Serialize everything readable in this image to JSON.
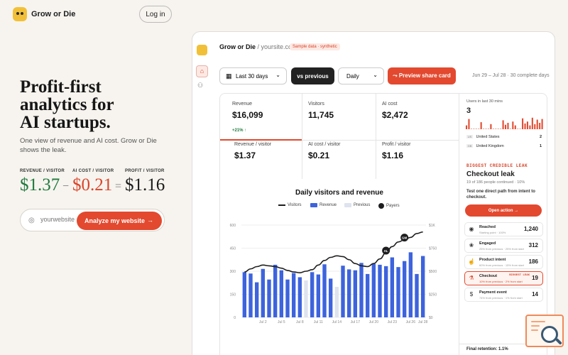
{
  "brand": {
    "name": "Grow or Die"
  },
  "nav": {
    "login": "Log in"
  },
  "hero": {
    "title_lines": [
      "Profit-first",
      "analytics for",
      "AI startups."
    ],
    "subtitle": "One view of revenue and AI cost. Grow or Die shows the leak."
  },
  "equation": {
    "revenue": {
      "label": "REVENUE / VISITOR",
      "value": "$1.37"
    },
    "minus": "−",
    "ai_cost": {
      "label": "AI COST / VISITOR",
      "value": "$0.21"
    },
    "equals": "=",
    "profit": {
      "label": "PROFIT / VISITOR",
      "value": "$1.16"
    }
  },
  "analyze": {
    "placeholder": "yourwebsite",
    "button": "Analyze my website",
    "arrow": "→"
  },
  "dashboard": {
    "title": "Grow or Die",
    "site": "/ yoursite.com",
    "badge": "Sample data · synthetic",
    "range": "Last 30 days",
    "compare": "vs previous",
    "granularity": "Daily",
    "share": "Preview share card",
    "share_icon": "share-icon",
    "date_range": "Jun 29 – Jul 28 · 30 complete days",
    "kpis": [
      {
        "label": "Revenue",
        "value": "$16,099",
        "delta": "+21% ↑"
      },
      {
        "label": "Visitors",
        "value": "11,745"
      },
      {
        "label": "AI cost",
        "value": "$2,472"
      },
      {
        "label": "Revenue / visitor",
        "value": "$1.37"
      },
      {
        "label": "AI cost / visitor",
        "value": "$0.21"
      },
      {
        "label": "Profit / visitor",
        "value": "$1.16"
      }
    ],
    "right": {
      "users_label": "Users in last 30 mins",
      "users_count": "3",
      "countries": [
        {
          "code": "US",
          "name": "United States",
          "count": "2"
        },
        {
          "code": "GB",
          "name": "United Kingdom",
          "count": "1"
        }
      ],
      "leak_label": "BIGGEST CREDIBLE LEAK",
      "leak_title": "Checkout leak",
      "leak_note": "19 of 186 people continued · 10%",
      "leak_desc": "Test one direct path from intent to checkout.",
      "open_action": "Open action →",
      "funnel": [
        {
          "icon": "◉",
          "name": "Reached",
          "sub": "Starting point · 100%",
          "value": "1,240"
        },
        {
          "icon": "❀",
          "name": "Engaged",
          "sub": "25% from previous · 25% from start",
          "value": "312"
        },
        {
          "icon": "☝",
          "name": "Product intent",
          "sub": "60% from previous · 15% from start",
          "value": "186"
        },
        {
          "icon": "⚗",
          "name": "Checkout",
          "sub": "10% from previous · 2% from start",
          "value": "19",
          "badge": "BIGGEST LEAK",
          "highlight": true
        },
        {
          "icon": "$",
          "name": "Payment event",
          "sub": "74% from previous · 1% from start",
          "value": "14"
        }
      ],
      "retention": "Final retention: 1.1%"
    }
  },
  "chart_data": {
    "type": "bar",
    "title": "Daily visitors and revenue",
    "legend": [
      "Visitors",
      "Revenue",
      "Previous",
      "Payers"
    ],
    "legend_placement": "top",
    "categories": [
      "Jun 29",
      "Jun 30",
      "Jul 1",
      "Jul 2",
      "Jul 3",
      "Jul 4",
      "Jul 5",
      "Jul 6",
      "Jul 7",
      "Jul 8",
      "Jul 9",
      "Jul 10",
      "Jul 11",
      "Jul 12",
      "Jul 13",
      "Jul 14",
      "Jul 15",
      "Jul 16",
      "Jul 17",
      "Jul 18",
      "Jul 19",
      "Jul 20",
      "Jul 21",
      "Jul 22",
      "Jul 23",
      "Jul 24",
      "Jul 25",
      "Jul 26",
      "Jul 27",
      "Jul 28"
    ],
    "x_tick_labels": [
      "Jul 2",
      "Jul 5",
      "Jul 8",
      "Jul 11",
      "Jul 14",
      "Jul 17",
      "Jul 20",
      "Jul 23",
      "Jul 26",
      "Jul 28"
    ],
    "x_tick_index": [
      3,
      6,
      9,
      12,
      15,
      18,
      21,
      24,
      27,
      29
    ],
    "yleft_ticks": [
      "600",
      "450",
      "300",
      "150",
      "0"
    ],
    "yleft_range": [
      0,
      600
    ],
    "yright_ticks": [
      "$1K",
      "$750",
      "$500",
      "$250",
      "$0"
    ],
    "yright_range": [
      0,
      1000
    ],
    "series": [
      {
        "name": "Revenue",
        "axis": "right",
        "color": "#3d63dd",
        "values": [
          490,
          475,
          380,
          525,
          410,
          570,
          510,
          410,
          480,
          435,
          530,
          490,
          465,
          575,
          420,
          540,
          560,
          520,
          510,
          590,
          470,
          580,
          570,
          555,
          650,
          545,
          610,
          705,
          470,
          665
        ]
      },
      {
        "name": "Previous",
        "axis": "right",
        "color": "#dde3ef",
        "values": [
          0,
          0,
          0,
          0,
          0,
          0,
          0,
          0,
          0,
          0,
          0,
          0,
          0,
          0,
          0,
          0,
          0,
          0,
          0,
          0,
          0,
          0,
          0,
          0,
          0,
          0,
          0,
          0,
          0,
          0
        ]
      },
      {
        "name": "Visitors",
        "axis": "left",
        "color": "#1d1d1f",
        "values": [
          295,
          315,
          330,
          340,
          335,
          330,
          320,
          305,
          295,
          290,
          300,
          310,
          340,
          370,
          390,
          400,
          395,
          375,
          350,
          335,
          330,
          350,
          380,
          420,
          460,
          490,
          505,
          520,
          545,
          555
        ]
      }
    ],
    "previous_overlay": [
      0,
      0,
      0,
      0,
      0,
      0,
      0,
      0,
      0,
      0,
      400,
      0,
      0,
      0,
      0,
      330,
      0,
      0,
      0,
      0,
      0,
      0,
      0,
      0,
      0,
      0,
      0,
      0,
      0,
      0
    ],
    "annotations": [
      {
        "label": "AL",
        "index": 23
      },
      {
        "label": "GM",
        "index": 26
      }
    ],
    "grid": true
  },
  "recent_users_bars": [
    0.3,
    0.8,
    0,
    0,
    0,
    0,
    0.55,
    0,
    0,
    0,
    0.4,
    0,
    0,
    0,
    0,
    0.7,
    0.35,
    0.5,
    0,
    0.6,
    0.3,
    0,
    0,
    0.85,
    0.45,
    0.6,
    0.3,
    0.9,
    0.4,
    0.75,
    0.5,
    0.8
  ],
  "colors": {
    "accent": "#e2492f",
    "revenue_bar": "#3d63dd",
    "good": "#1f7a3d",
    "brand_yellow": "#f2c038"
  }
}
